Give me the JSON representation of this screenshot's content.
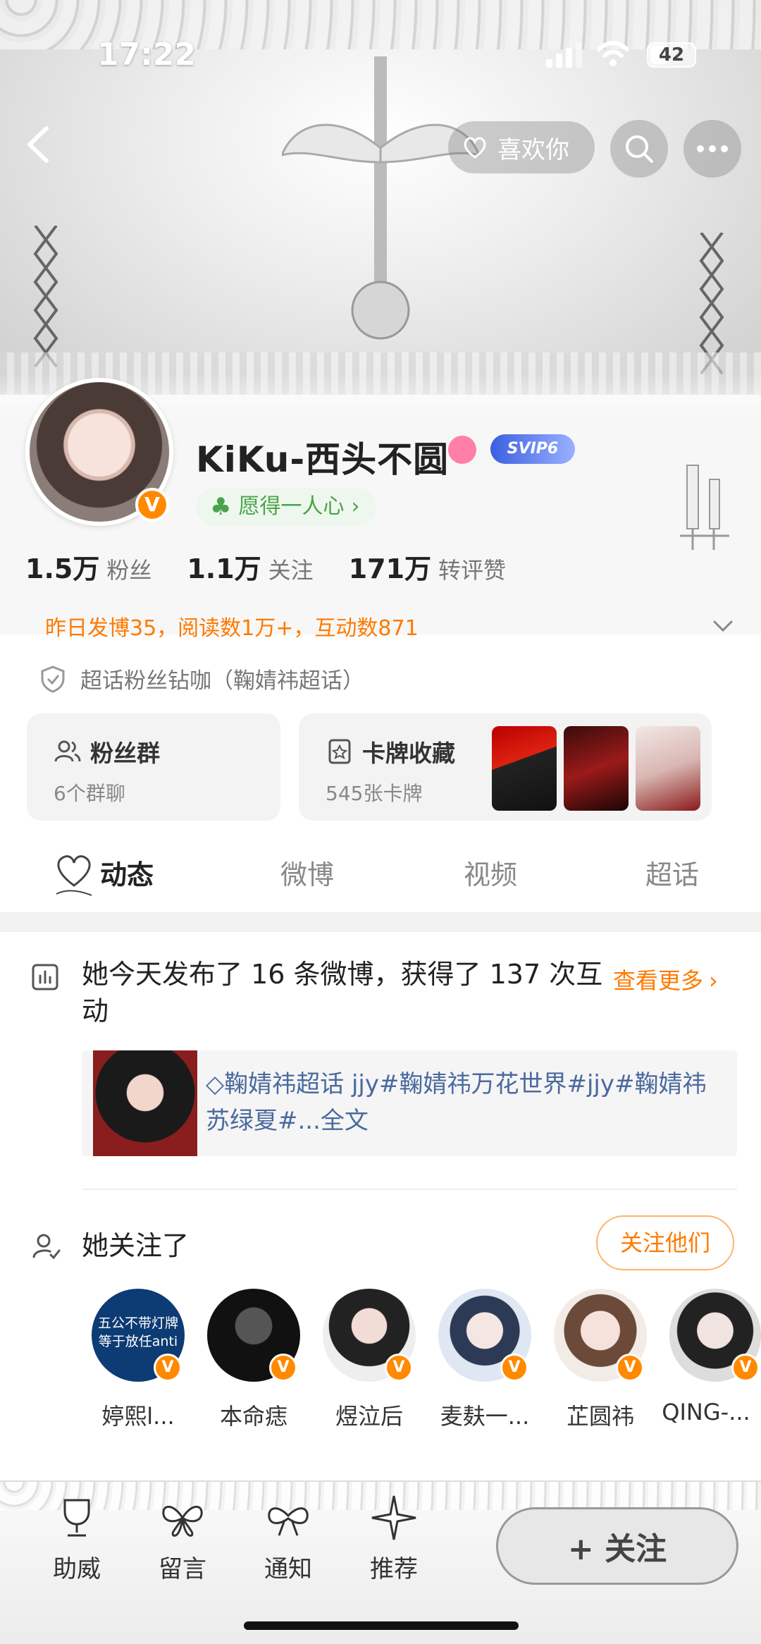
{
  "status_bar": {
    "time": "17:22",
    "battery": "42"
  },
  "top_nav": {
    "like_label": "喜欢你"
  },
  "profile": {
    "username": "KiKu-西头不圆",
    "vip_label": "SVIP6",
    "verified_mark": "V",
    "motto": "愿得一人心",
    "motto_chevron": "›",
    "stats": [
      {
        "value": "1.5万",
        "label": "粉丝"
      },
      {
        "value": "1.1万",
        "label": "关注"
      },
      {
        "value": "171万",
        "label": "转评赞"
      }
    ],
    "activity": "昨日发博35，阅读数1万+，互动数871",
    "chaohua": "超话粉丝钻咖（鞠婧祎超话）"
  },
  "cards": {
    "fans_group": {
      "title": "粉丝群",
      "subtitle": "6个群聊"
    },
    "card_collection": {
      "title": "卡牌收藏",
      "subtitle": "545张卡牌"
    }
  },
  "tabs": [
    {
      "label": "动态",
      "active": true
    },
    {
      "label": "微博",
      "active": false
    },
    {
      "label": "视频",
      "active": false
    },
    {
      "label": "超话",
      "active": false
    }
  ],
  "summary": {
    "text": "她今天发布了 16 条微博，获得了 137 次互动",
    "more": "查看更多",
    "more_chevron": "›",
    "post_text": "鞠婧祎超话 jjy#鞠婧祎万花世界#jjy#鞠婧祎苏绿夏#...全文"
  },
  "following": {
    "title": "她关注了",
    "button": "关注他们",
    "users": [
      {
        "name": "婷熙l...",
        "avatar_text": "五公不带灯牌\n等于放任anti"
      },
      {
        "name": "本命痣"
      },
      {
        "name": "煜泣后"
      },
      {
        "name": "麦麸一..."
      },
      {
        "name": "芷圆祎"
      },
      {
        "name": "QING-..."
      }
    ]
  },
  "bottom_bar": {
    "items": [
      {
        "label": "助威",
        "icon": "trophy-icon"
      },
      {
        "label": "留言",
        "icon": "butterfly-icon"
      },
      {
        "label": "通知",
        "icon": "bow-icon"
      },
      {
        "label": "推荐",
        "icon": "sparkle-icon"
      }
    ],
    "follow_label": "+ 关注"
  },
  "colors": {
    "accent": "#ff7a00",
    "link": "#4a6a9e",
    "green": "#4aa34a"
  }
}
